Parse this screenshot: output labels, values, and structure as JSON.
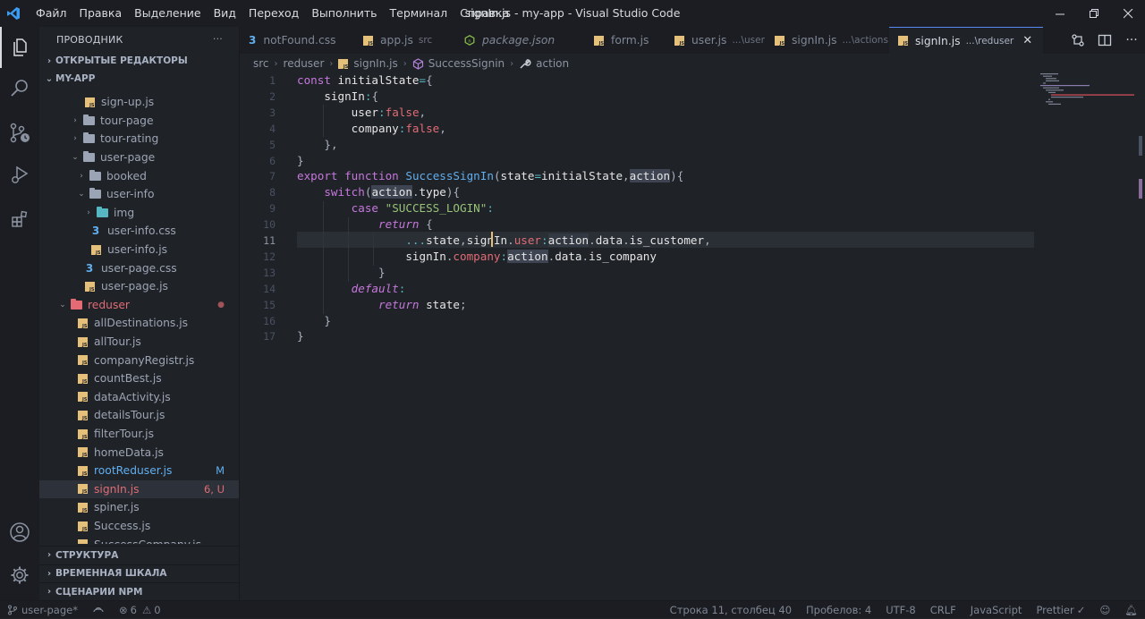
{
  "title": "signIn.js - my-app - Visual Studio Code",
  "menu": [
    "Файл",
    "Правка",
    "Выделение",
    "Вид",
    "Переход",
    "Выполнить",
    "Терминал",
    "Справка"
  ],
  "sidebar": {
    "header": "ПРОВОДНИК",
    "open_editors": "ОТКРЫТЫЕ РЕДАКТОРЫ",
    "project": "MY-APP",
    "tree": [
      {
        "label": "sign-up.js",
        "kind": "js"
      },
      {
        "label": "tour-page",
        "kind": "folder"
      },
      {
        "label": "tour-rating",
        "kind": "folder"
      },
      {
        "label": "user-page",
        "kind": "folder-open"
      },
      {
        "label": "booked",
        "kind": "folder"
      },
      {
        "label": "user-info",
        "kind": "folder-open"
      },
      {
        "label": "img",
        "kind": "folder-img"
      },
      {
        "label": "user-info.css",
        "kind": "css"
      },
      {
        "label": "user-info.js",
        "kind": "js"
      },
      {
        "label": "user-page.css",
        "kind": "css"
      },
      {
        "label": "user-page.js",
        "kind": "js"
      },
      {
        "label": "reduser",
        "kind": "folder-red",
        "badge": "●"
      },
      {
        "label": "allDestinations.js",
        "kind": "js"
      },
      {
        "label": "allTour.js",
        "kind": "js"
      },
      {
        "label": "companyRegistr.js",
        "kind": "js"
      },
      {
        "label": "countBest.js",
        "kind": "js"
      },
      {
        "label": "dataActivity.js",
        "kind": "js"
      },
      {
        "label": "detailsTour.js",
        "kind": "js"
      },
      {
        "label": "filterTour.js",
        "kind": "js"
      },
      {
        "label": "homeData.js",
        "kind": "js"
      },
      {
        "label": "rootReduser.js",
        "kind": "js",
        "badge": "M"
      },
      {
        "label": "signIn.js",
        "kind": "js",
        "badge": "6, U"
      },
      {
        "label": "spiner.js",
        "kind": "js"
      },
      {
        "label": "Success.js",
        "kind": "js"
      },
      {
        "label": "SuccessCompany.js",
        "kind": "js"
      }
    ],
    "bottom_sections": [
      "СТРУКТУРА",
      "ВРЕМЕННАЯ ШКАЛА",
      "СЦЕНАРИИ NPM"
    ]
  },
  "tabs": [
    {
      "label": "notFound.css",
      "icon": "css",
      "hint": ""
    },
    {
      "label": "app.js",
      "icon": "js",
      "hint": "src"
    },
    {
      "label": "package.json",
      "icon": "npm",
      "hint": ""
    },
    {
      "label": "form.js",
      "icon": "js",
      "hint": ""
    },
    {
      "label": "user.js",
      "icon": "js",
      "hint": "...\\user"
    },
    {
      "label": "signIn.js",
      "icon": "js",
      "hint": "...\\actions"
    },
    {
      "label": "signIn.js",
      "icon": "js",
      "hint": "...\\reduser"
    }
  ],
  "breadcrumb": [
    "src",
    "reduser",
    "signIn.js",
    "SuccessSignin",
    "action"
  ],
  "editor": {
    "line_numbers": [
      "1",
      "2",
      "3",
      "4",
      "5",
      "6",
      "7",
      "8",
      "9",
      "10",
      "11",
      "12",
      "13",
      "14",
      "15",
      "16",
      "17"
    ],
    "lines": [
      "const initialState={",
      "    signIn:{",
      "        user:false,",
      "        company:false,",
      "    },",
      "}",
      "export function SuccessSignIn(state=initialState,action){",
      "    switch(action.type){",
      "        case \"SUCCESS_LOGIN\":",
      "            return {",
      "                ...state,signIn.user:action.data.is_customer,",
      "                signIn.company:action.data.is_company",
      "            }",
      "        default:",
      "            return state;",
      "    }",
      "}"
    ]
  },
  "status": {
    "branch": "user-page*",
    "problems": "6",
    "warnings": "0",
    "position": "Строка 11, столбец 40",
    "spaces": "Пробелов: 4",
    "encoding": "UTF-8",
    "eol": "CRLF",
    "language": "JavaScript",
    "formatter": "Prettier"
  },
  "colors": {
    "accent": "#568af2",
    "modified": "#e06c75",
    "js": "#e5c07b",
    "css": "#61afef"
  }
}
